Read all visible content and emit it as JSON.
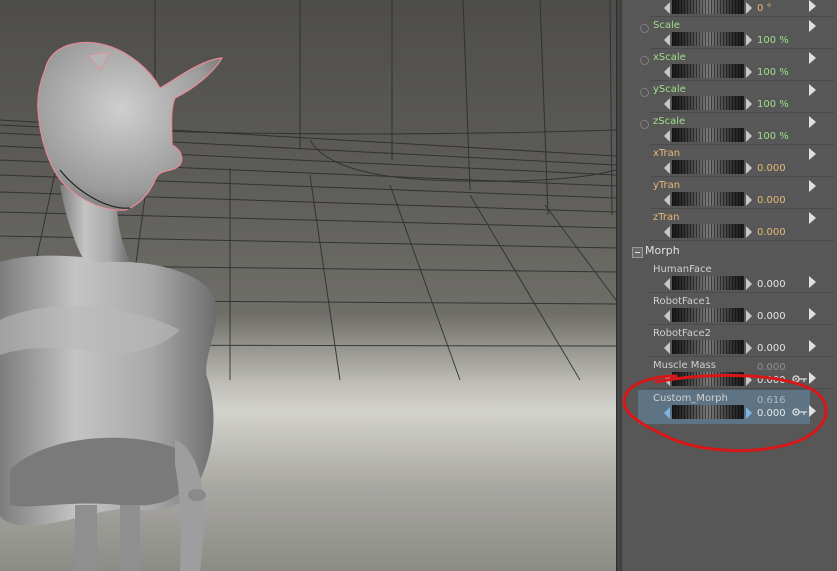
{
  "colors": {
    "label_green": "#9fe08a",
    "label_orange": "#e9b77b",
    "panel_bg": "#575757",
    "selected_row": "#5e7484",
    "annotation_red": "#d81818"
  },
  "viewport": {
    "figure": "grey-humanoid-figure-with-selected-head",
    "floor": "perspective-grid-floor"
  },
  "parameters": {
    "top_row": {
      "value": "0 °"
    },
    "scale_group": [
      {
        "label": "Scale",
        "value": "100 %"
      },
      {
        "label": "xScale",
        "value": "100 %"
      },
      {
        "label": "yScale",
        "value": "100 %"
      },
      {
        "label": "zScale",
        "value": "100 %"
      }
    ],
    "translate_group": [
      {
        "label": "xTran",
        "value": "0.000"
      },
      {
        "label": "yTran",
        "value": "0.000"
      },
      {
        "label": "zTran",
        "value": "0.000"
      }
    ],
    "morph_header": "Morph",
    "morphs": [
      {
        "label": "HumanFace",
        "value": "0.000",
        "value2": ""
      },
      {
        "label": "RobotFace1",
        "value": "0.000",
        "value2": ""
      },
      {
        "label": "RobotFace2",
        "value": "0.000",
        "value2": ""
      },
      {
        "label": "Muscle Mass",
        "value": "0.000",
        "value2": "0.000"
      },
      {
        "label": "Custom_Morph",
        "value": "0.000",
        "value2": "0.616"
      }
    ]
  }
}
